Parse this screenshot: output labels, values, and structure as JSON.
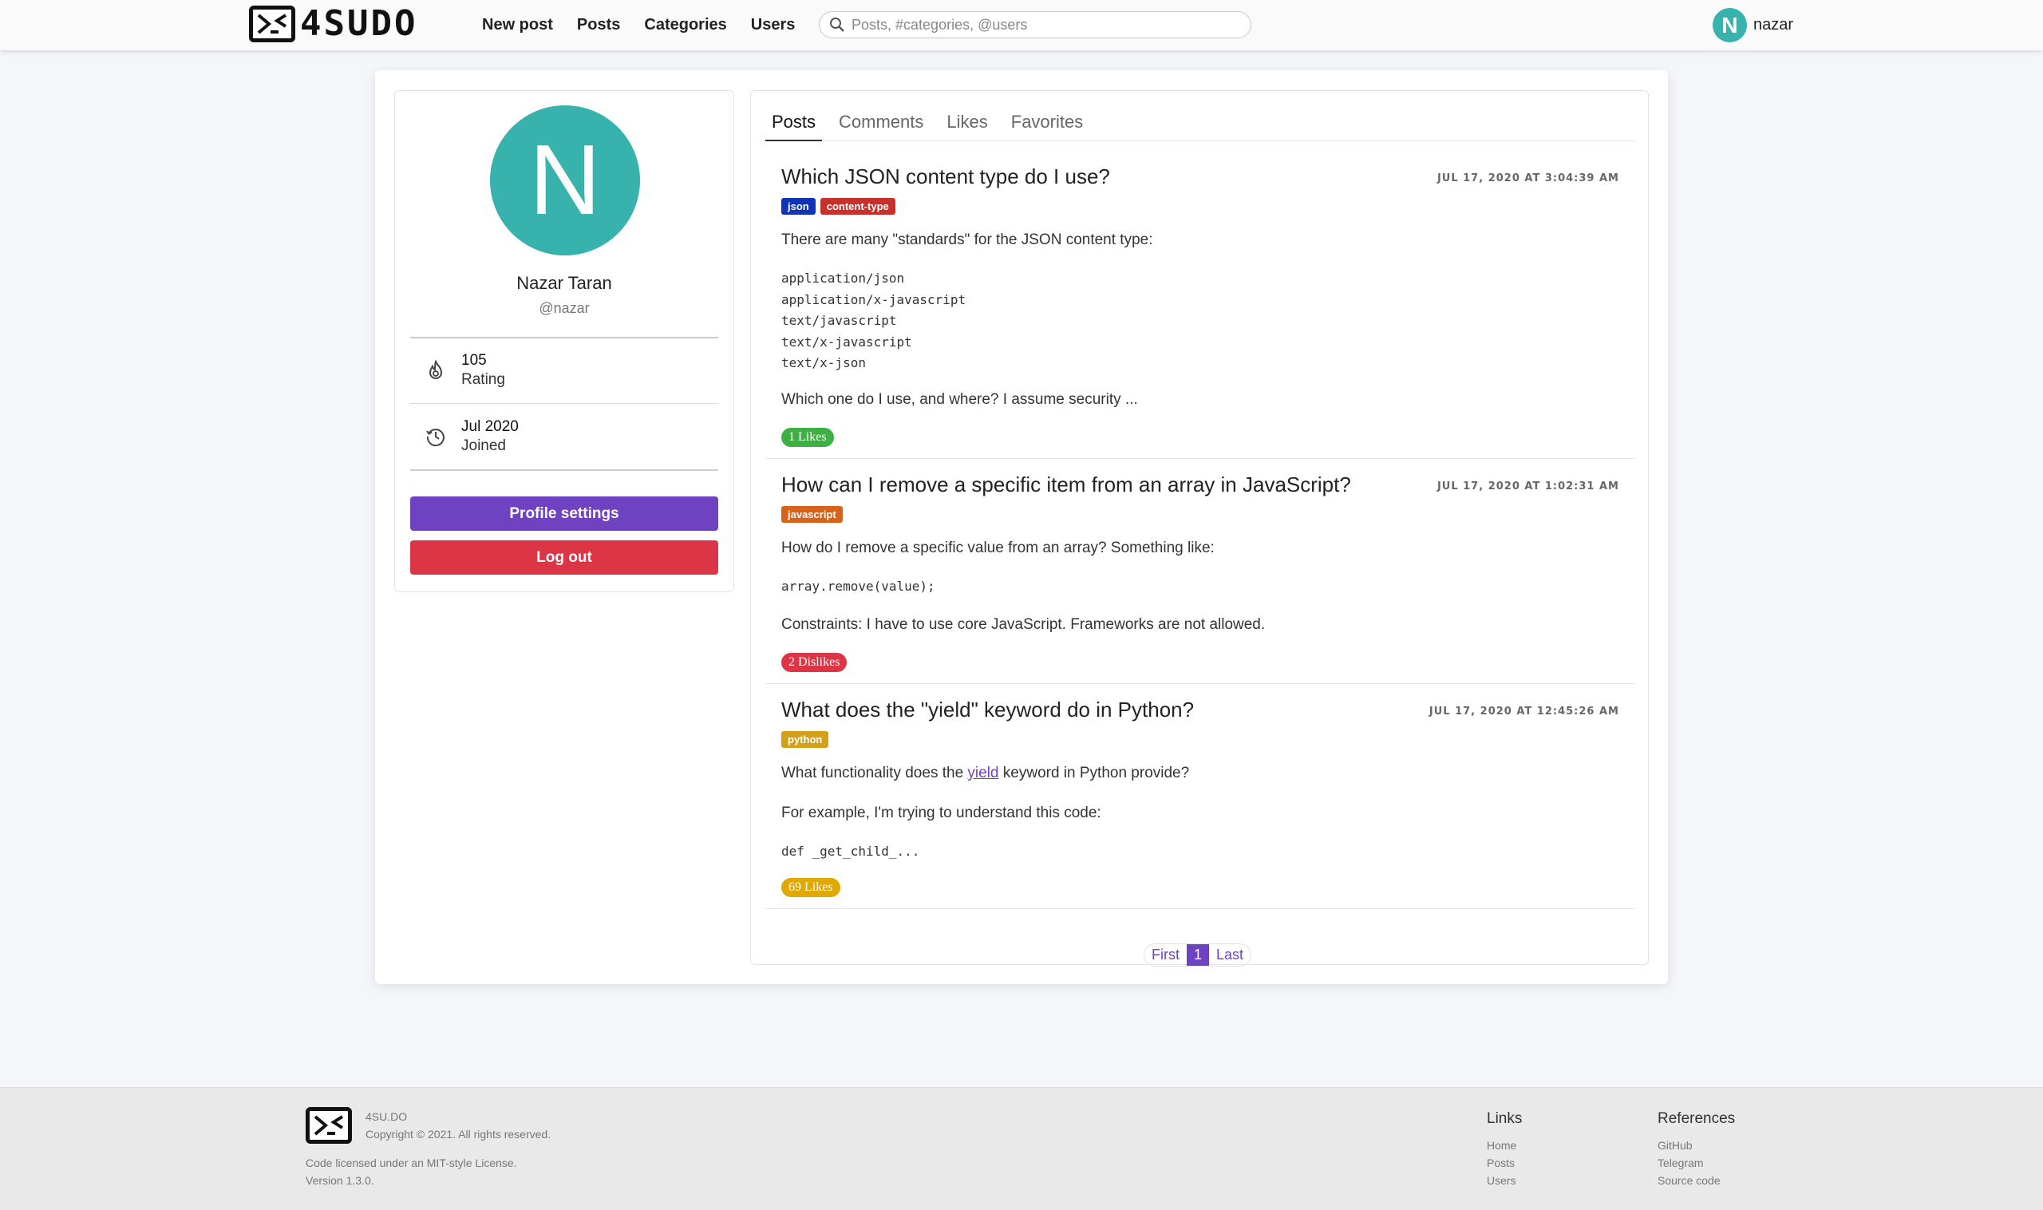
{
  "nav": {
    "logo_text": "4SUDO",
    "links": [
      "New post",
      "Posts",
      "Categories",
      "Users"
    ],
    "search_placeholder": "Posts, #categories, @users",
    "user_initial": "N",
    "user_name": "nazar"
  },
  "profile": {
    "initial": "N",
    "name": "Nazar Taran",
    "handle": "@nazar",
    "rating_value": "105",
    "rating_label": "Rating",
    "joined_value": "Jul 2020",
    "joined_label": "Joined",
    "settings_button": "Profile settings",
    "logout_button": "Log out"
  },
  "tabs": [
    "Posts",
    "Comments",
    "Likes",
    "Favorites"
  ],
  "posts": [
    {
      "title": "Which JSON content type do I use?",
      "date": "JUL 17, 2020 AT 3:04:39 AM",
      "tags": [
        {
          "name": "json",
          "color": "#1034b8"
        },
        {
          "name": "content-type",
          "color": "#c9302c"
        }
      ],
      "text1": "There are many \"standards\" for the JSON content type:",
      "code": [
        "application/json",
        "application/x-javascript",
        "text/javascript",
        "text/x-javascript",
        "text/x-json"
      ],
      "text2": "Which one do I use, and where? I assume security ...",
      "reaction": "1 Likes",
      "reaction_color": "#3cb043"
    },
    {
      "title": "How can I remove a specific item from an array in JavaScript?",
      "date": "JUL 17, 2020 AT 1:02:31 AM",
      "tags": [
        {
          "name": "javascript",
          "color": "#d9621a"
        }
      ],
      "text1": "How do I remove a specific value from an array? Something like:",
      "code": [
        "array.remove(value);"
      ],
      "text2": "Constraints: I have to use core JavaScript. Frameworks are not allowed.",
      "reaction": "2 Dislikes",
      "reaction_color": "#dc3545"
    },
    {
      "title": "What does the \"yield\" keyword do in Python?",
      "date": "JUL 17, 2020 AT 12:45:26 AM",
      "tags": [
        {
          "name": "python",
          "color": "#d4a017"
        }
      ],
      "text1_before": "What functionality does the ",
      "text1_link": "yield",
      "text1_after": " keyword in Python provide?",
      "text2": "For example, I'm trying to understand this code:",
      "code": [
        "def _get_child_..."
      ],
      "reaction": "69 Likes",
      "reaction_color": "#e0a800"
    }
  ],
  "pager": {
    "first": "First",
    "current": "1",
    "last": "Last"
  },
  "footer": {
    "brand": "4SU.DO",
    "copyright": "Copyright © 2021. All rights reserved.",
    "license": "Code licensed under an MIT-style License.",
    "version": "Version 1.3.0.",
    "links_heading": "Links",
    "links": [
      "Home",
      "Posts",
      "Users"
    ],
    "refs_heading": "References",
    "refs": [
      "GitHub",
      "Telegram",
      "Source code"
    ]
  }
}
